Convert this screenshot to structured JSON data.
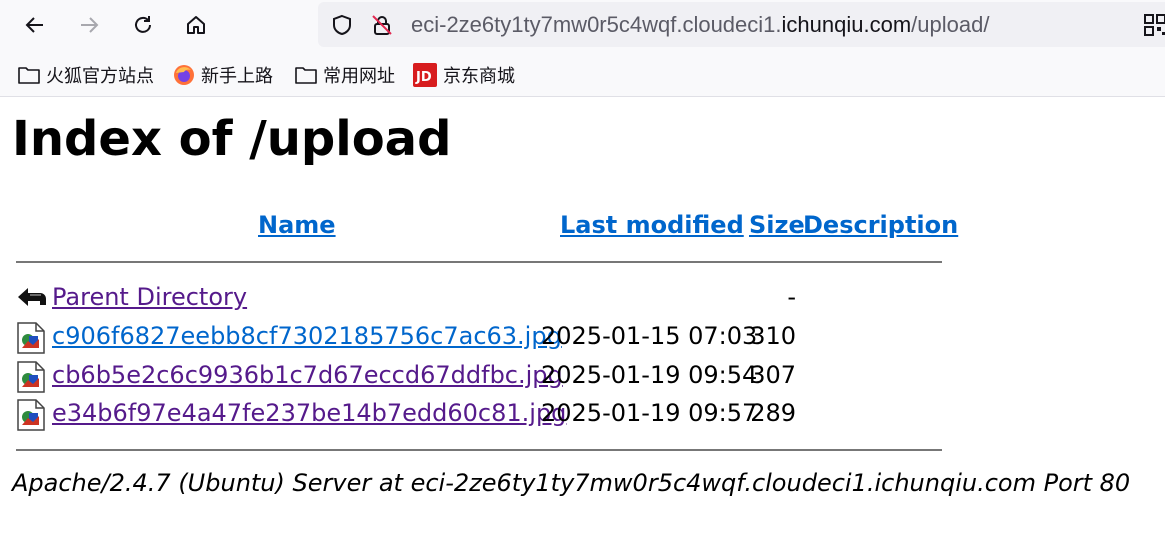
{
  "browser": {
    "url_prefix": "eci-2ze6ty1ty7mw0r5c4wqf.cloudeci1.",
    "url_domain": "ichunqiu.com",
    "url_path": "/upload/",
    "bookmarks": [
      {
        "label": "火狐官方站点",
        "icon": "folder-icon"
      },
      {
        "label": "新手上路",
        "icon": "firefox-icon"
      },
      {
        "label": "常用网址",
        "icon": "folder-icon"
      },
      {
        "label": "京东商城",
        "icon": "jd-icon"
      }
    ]
  },
  "page": {
    "title": "Index of /upload",
    "columns": {
      "name": "Name",
      "modified": "Last modified",
      "size": "Size",
      "description": "Description"
    },
    "parent": {
      "label": "Parent Directory",
      "size": "-"
    },
    "files": [
      {
        "name": "c906f6827eebb8cf7302185756c7ac63.jpg",
        "modified": "2025-01-15 07:03",
        "size": "310"
      },
      {
        "name": "cb6b5e2c6c9936b1c7d67eccd67ddfbc.jpg",
        "modified": "2025-01-19 09:54",
        "size": "307"
      },
      {
        "name": "e34b6f97e4a47fe237be14b7edd60c81.jpg",
        "modified": "2025-01-19 09:57",
        "size": "289"
      }
    ],
    "address": "Apache/2.4.7 (Ubuntu) Server at eci-2ze6ty1ty7mw0r5c4wqf.cloudeci1.ichunqiu.com Port 80"
  },
  "colors": {
    "link": "#0066cc",
    "visited": "#551a8b"
  }
}
